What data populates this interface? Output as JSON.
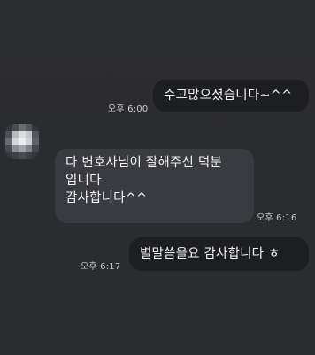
{
  "messages": [
    {
      "direction": "outgoing",
      "text": "수고많으셨습니다~^^",
      "time": "오후 6:00"
    },
    {
      "direction": "incoming",
      "text": "다 변호사님이 잘해주신 덕분\n입니다\n감사합니다^^",
      "time": "오후 6:16"
    },
    {
      "direction": "outgoing",
      "text": "별말씀을요 감사합니다 ㅎ",
      "time": "오후 6:17"
    }
  ],
  "colors": {
    "background": "#2b2c30",
    "outgoing_bubble": "#1d1e22",
    "incoming_bubble": "#3a3b40",
    "text": "#f4f4f4",
    "time": "#c9cacd"
  }
}
